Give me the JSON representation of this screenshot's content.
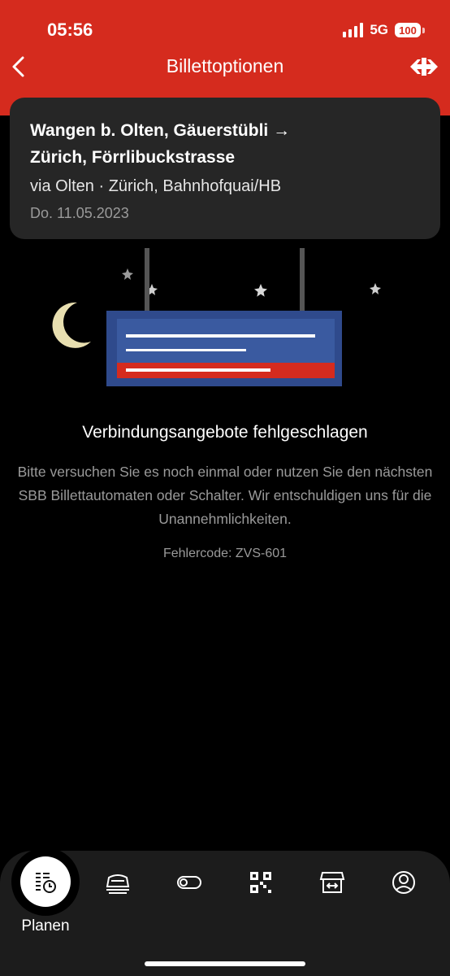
{
  "status_bar": {
    "time": "05:56",
    "network": "5G",
    "battery": "100"
  },
  "header": {
    "title": "Billettoptionen",
    "back_icon": "chevron-left-icon",
    "logo_icon": "sbb-logo-icon"
  },
  "trip": {
    "from": "Wangen b. Olten, Gäuerstübli",
    "arrow": "→",
    "to": "Zürich, Förrlibuckstrasse",
    "via": "via Olten · Zürich, Bahnhofquai/HB",
    "date": "Do. 11.05.2023"
  },
  "error": {
    "title": "Verbindungsangebote fehlgeschlagen",
    "message": "Bitte versuchen Sie es noch einmal oder nutzen Sie den nächsten SBB Billettautomaten oder Schalter. Wir entschuldigen uns für die Unannehmlichkeiten.",
    "code": "Fehlercode: ZVS-601"
  },
  "bottom_nav": {
    "items": [
      {
        "label": "Planen",
        "icon": "timetable-clock-icon",
        "active": true
      },
      {
        "label": "",
        "icon": "train-icon",
        "active": false
      },
      {
        "label": "",
        "icon": "toggle-icon",
        "active": false
      },
      {
        "label": "",
        "icon": "qr-code-icon",
        "active": false
      },
      {
        "label": "",
        "icon": "shop-icon",
        "active": false
      },
      {
        "label": "",
        "icon": "user-icon",
        "active": false
      }
    ]
  },
  "colors": {
    "brand_red": "#d52b1e",
    "card_bg": "#262626",
    "nav_bg": "#1c1c1c",
    "muted_text": "#9a9a9a"
  }
}
